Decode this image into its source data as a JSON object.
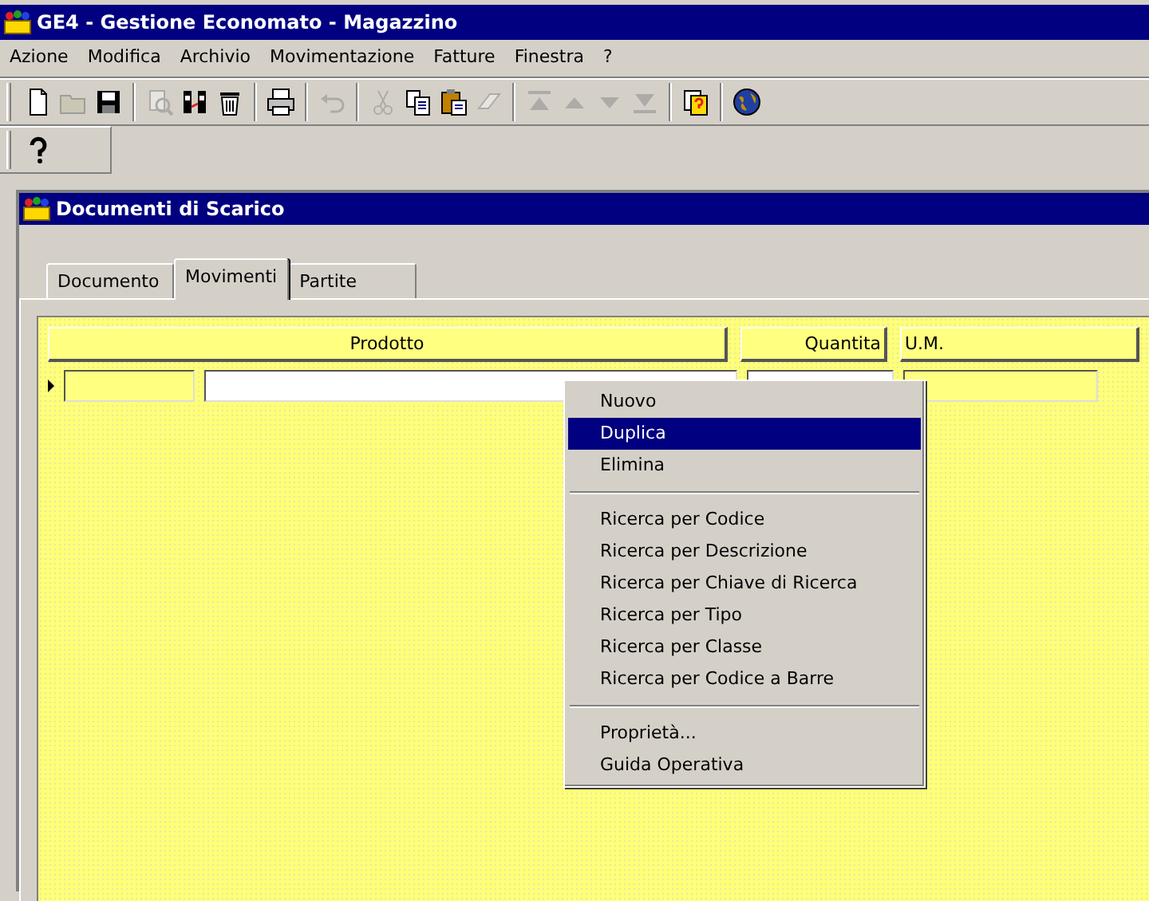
{
  "window": {
    "title": "GE4 - Gestione Economato - Magazzino"
  },
  "menu_bar": [
    "Azione",
    "Modifica",
    "Archivio",
    "Movimentazione",
    "Fatture",
    "Finestra",
    "?"
  ],
  "toolbar": [
    {
      "kind": "new",
      "disabled": false
    },
    {
      "kind": "open",
      "disabled": true
    },
    {
      "kind": "save",
      "disabled": false
    },
    {
      "kind": "sep"
    },
    {
      "kind": "find",
      "disabled": true
    },
    {
      "kind": "columns",
      "disabled": false
    },
    {
      "kind": "trash",
      "disabled": false
    },
    {
      "kind": "sep"
    },
    {
      "kind": "print",
      "disabled": false
    },
    {
      "kind": "sep"
    },
    {
      "kind": "undo",
      "disabled": true
    },
    {
      "kind": "sep"
    },
    {
      "kind": "cut",
      "disabled": true
    },
    {
      "kind": "copy",
      "disabled": false
    },
    {
      "kind": "paste",
      "disabled": false
    },
    {
      "kind": "eraser",
      "disabled": true
    },
    {
      "kind": "sep"
    },
    {
      "kind": "first",
      "disabled": true
    },
    {
      "kind": "up",
      "disabled": true
    },
    {
      "kind": "down",
      "disabled": true
    },
    {
      "kind": "last",
      "disabled": true
    },
    {
      "kind": "sep"
    },
    {
      "kind": "helpdoc",
      "disabled": false
    },
    {
      "kind": "sep"
    },
    {
      "kind": "globe",
      "disabled": false
    }
  ],
  "toolbar2": [
    {
      "kind": "help",
      "disabled": false
    }
  ],
  "child_window": {
    "title": "Documenti di Scarico",
    "tabs": [
      {
        "label": "Documento",
        "selected": false
      },
      {
        "label": "Movimenti",
        "selected": true
      },
      {
        "label": "Partite",
        "selected": false
      }
    ],
    "grid": {
      "columns": [
        "Prodotto",
        "Quantita",
        "U.M."
      ]
    },
    "context_menu": [
      {
        "kind": "item",
        "label": "Nuovo",
        "selected": false
      },
      {
        "kind": "item",
        "label": "Duplica",
        "selected": true
      },
      {
        "kind": "item",
        "label": "Elimina",
        "selected": false
      },
      {
        "kind": "sep"
      },
      {
        "kind": "item",
        "label": "Ricerca per Codice",
        "selected": false
      },
      {
        "kind": "item",
        "label": "Ricerca per Descrizione",
        "selected": false
      },
      {
        "kind": "item",
        "label": "Ricerca per Chiave di Ricerca",
        "selected": false
      },
      {
        "kind": "item",
        "label": "Ricerca per Tipo",
        "selected": false
      },
      {
        "kind": "item",
        "label": "Ricerca per Classe",
        "selected": false
      },
      {
        "kind": "item",
        "label": "Ricerca per Codice a Barre",
        "selected": false
      },
      {
        "kind": "sep"
      },
      {
        "kind": "item",
        "label": "Proprietà...",
        "selected": false
      },
      {
        "kind": "item",
        "label": "Guida Operativa",
        "selected": false
      }
    ]
  }
}
